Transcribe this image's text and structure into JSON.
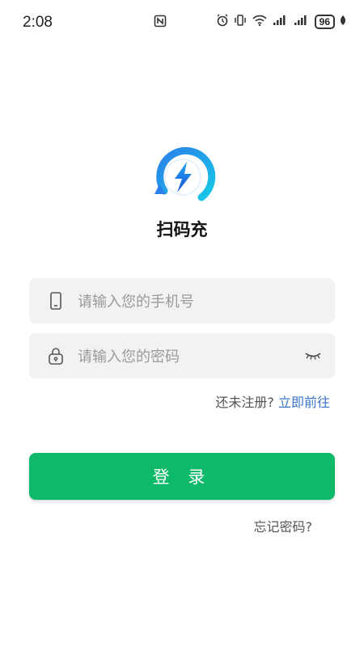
{
  "status_bar": {
    "time": "2:08",
    "battery": "96",
    "icons": [
      "nfc-icon",
      "alarm-icon",
      "vibrate-icon",
      "wifi-icon",
      "signal-icon",
      "signal-icon",
      "battery-icon",
      "leaf-icon"
    ]
  },
  "app": {
    "name": "扫码充",
    "logo": "lightning-bolt-logo",
    "accent": "#1e90e6"
  },
  "form": {
    "phone_placeholder": "请输入您的手机号",
    "password_placeholder": "请输入您的密码",
    "phone_icon": "phone-icon",
    "lock_icon": "lock-icon",
    "eye_icon": "eye-closed-icon"
  },
  "register": {
    "prompt": "还未注册?",
    "link": "立即前往"
  },
  "login_button": {
    "label": "登 录",
    "color": "#0fb96a"
  },
  "forgot_password": "忘记密码?"
}
